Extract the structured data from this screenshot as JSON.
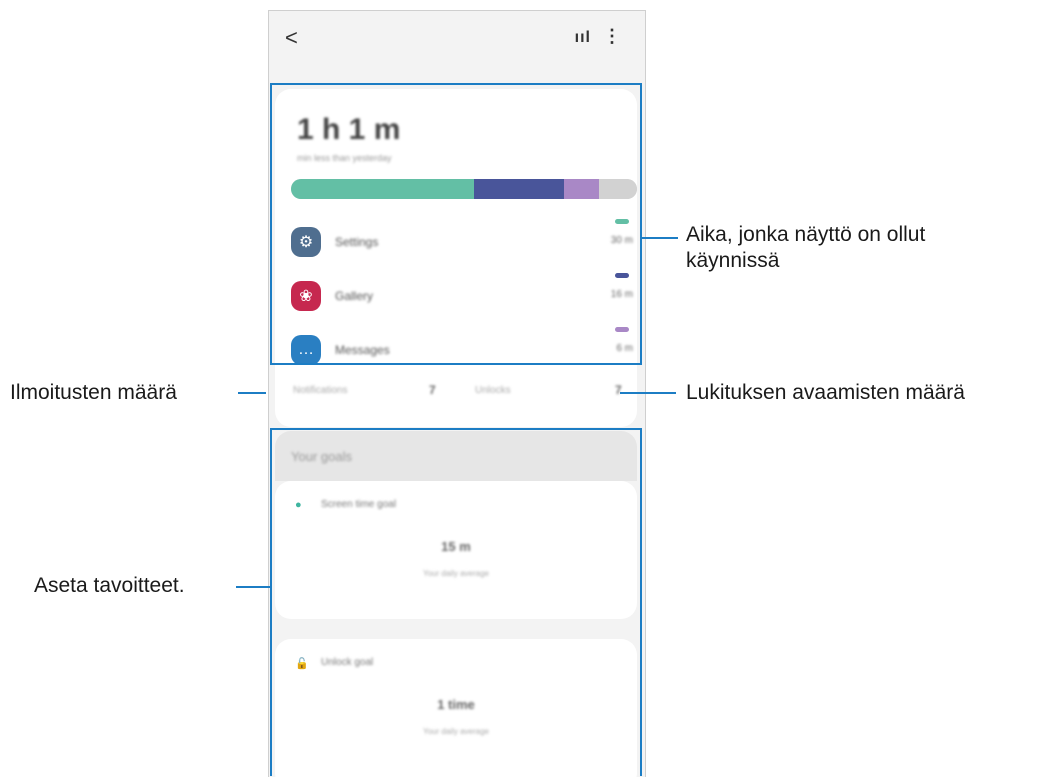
{
  "topbar": {
    "back_glyph": "<",
    "signal_glyph": "ııl",
    "more_glyph": "⋮"
  },
  "summary": {
    "total_time": "1 h 1 m",
    "subline": "min less than yesterday",
    "bar_segments": [
      {
        "share": 0.53,
        "color": "#63bfa5"
      },
      {
        "share": 0.26,
        "color": "#49559a"
      },
      {
        "share": 0.1,
        "color": "#a988c6"
      },
      {
        "share": 0.11,
        "color": "#d2d2d2"
      }
    ],
    "apps": [
      {
        "name": "Settings",
        "time": "30 m",
        "icon": "gear-icon",
        "icon_bg": "#4f6e8f",
        "glyph": "⚙",
        "pill": "#63bfa5"
      },
      {
        "name": "Gallery",
        "time": "16 m",
        "icon": "flower-icon",
        "icon_bg": "#c6284f",
        "glyph": "❀",
        "pill": "#49559a"
      },
      {
        "name": "Messages",
        "time": "6 m",
        "icon": "chat-icon",
        "icon_bg": "#2a7fc2",
        "glyph": "…",
        "pill": "#a988c6"
      }
    ]
  },
  "stats": {
    "notifications_label": "Notifications",
    "notifications_value": "7",
    "unlocks_label": "Unlocks",
    "unlocks_value": "7"
  },
  "goals": {
    "title": "Your goals",
    "screen_time": {
      "label": "Screen time goal",
      "value": "15 m",
      "sub": "Your daily average",
      "icon_color": "#3fb5a0"
    },
    "unlock": {
      "label": "Unlock goal",
      "value": "1 time",
      "sub": "Your daily average",
      "icon_color": "#3e5a8c"
    }
  },
  "annotations": {
    "screen_time": "Aika, jonka näyttö on ollut\nkäynnissä",
    "notifications": "Ilmoitusten määrä",
    "unlocks": "Lukituksen avaamisten määrä",
    "goals": "Aseta tavoitteet."
  },
  "accent": "#1c7dc4"
}
